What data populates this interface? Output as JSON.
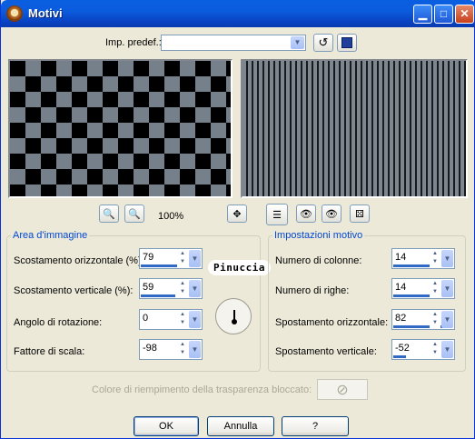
{
  "window": {
    "title": "Motivi"
  },
  "preset": {
    "label": "Imp. predef.:",
    "value": ""
  },
  "zoom": {
    "level": "100%"
  },
  "area": {
    "legend": "Area d'immagine",
    "horizontal_offset": {
      "label": "Scostamento orizzontale (%):",
      "value": "79",
      "level": 0.79
    },
    "vertical_offset": {
      "label": "Scostamento verticale (%):",
      "value": "59",
      "level": 0.59
    },
    "rotation_angle": {
      "label": "Angolo di rotazione:",
      "value": "0"
    },
    "scale_factor": {
      "label": "Fattore di scala:",
      "value": "-98"
    }
  },
  "watermark": "Pinuccia",
  "pattern": {
    "legend": "Impostazioni motivo",
    "columns": {
      "label": "Numero di colonne:",
      "value": "14"
    },
    "rows": {
      "label": "Numero di righe:",
      "value": "14"
    },
    "h_shift": {
      "label": "Spostamento orizzontale:",
      "value": "82"
    },
    "v_shift": {
      "label": "Spostamento verticale:",
      "value": "-52"
    }
  },
  "transparency": {
    "label": "Colore di riempimento della trasparenza bloccato:"
  },
  "buttons": {
    "ok": "OK",
    "cancel": "Annulla",
    "help": "?"
  },
  "colors": {
    "title_bar": "#0A5FE0",
    "dialog_bg": "#ECE9D8",
    "legend": "#0046D5",
    "accent": "#316AC5"
  }
}
